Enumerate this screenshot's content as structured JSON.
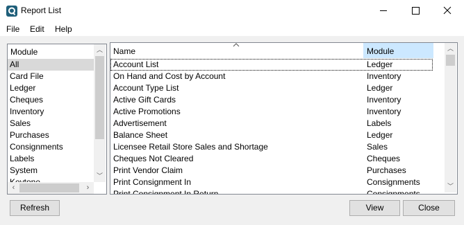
{
  "window": {
    "title": "Report List"
  },
  "menu": {
    "file": "File",
    "edit": "Edit",
    "help": "Help"
  },
  "modules": {
    "header": "Module",
    "items": [
      "All",
      "Card File",
      "Ledger",
      "Cheques",
      "Inventory",
      "Sales",
      "Purchases",
      "Consignments",
      "Labels",
      "System",
      "Keytone"
    ],
    "selected": "All"
  },
  "reports": {
    "columns": {
      "name": "Name",
      "module": "Module"
    },
    "rows": [
      {
        "name": "Account List",
        "module": "Ledger"
      },
      {
        "name": "On Hand and Cost by Account",
        "module": "Inventory"
      },
      {
        "name": "Account Type List",
        "module": "Ledger"
      },
      {
        "name": "Active Gift Cards",
        "module": "Inventory"
      },
      {
        "name": "Active Promotions",
        "module": "Inventory"
      },
      {
        "name": "Advertisement",
        "module": "Labels"
      },
      {
        "name": "Balance Sheet",
        "module": "Ledger"
      },
      {
        "name": "Licensee Retail Store Sales and Shortage",
        "module": "Sales"
      },
      {
        "name": "Cheques Not Cleared",
        "module": "Cheques"
      },
      {
        "name": "Print Vendor Claim",
        "module": "Purchases"
      },
      {
        "name": "Print Consignment In",
        "module": "Consignments"
      },
      {
        "name": "Print Consignment In Return",
        "module": "Consignments"
      }
    ]
  },
  "buttons": {
    "refresh": "Refresh",
    "view": "View",
    "close": "Close"
  },
  "colors": {
    "selection": "#d9d9d9",
    "header_highlight": "#cce8ff",
    "border": "#828790",
    "accent": "#0f7b8c"
  }
}
